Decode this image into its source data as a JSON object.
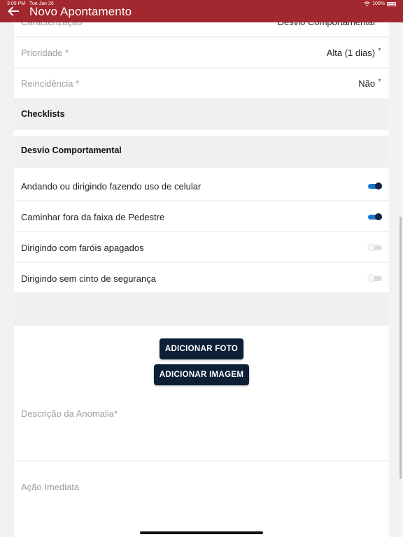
{
  "status_bar": {
    "time": "3:09 PM",
    "date": "Tue Jan 26",
    "battery": "100%"
  },
  "header": {
    "title": "Novo Apontamento"
  },
  "fields": [
    {
      "label": "Caracterização",
      "value": "Desvio Comportamental"
    },
    {
      "label": "Prioridade *",
      "value": "Alta (1 dias)"
    },
    {
      "label": "Reincidência *",
      "value": "Não"
    }
  ],
  "sections": {
    "checklists": "Checklists",
    "desvio": "Desvio Comportamental"
  },
  "checklist_items": [
    {
      "label": "Andando ou dirigindo fazendo uso de celular",
      "checked": true
    },
    {
      "label": "Caminhar fora da faixa de Pedestre",
      "checked": true
    },
    {
      "label": "Dirigindo com faróis apagados",
      "checked": false
    },
    {
      "label": "Dirigindo sem cinto de segurança",
      "checked": false
    }
  ],
  "buttons": {
    "add_photo": "ADICIONAR FOTO",
    "add_image": "ADICIONAR IMAGEM"
  },
  "text_fields": {
    "descricao_placeholder": "Descrição da Anomalia*",
    "acao_placeholder": "Ação Imediata"
  },
  "colors": {
    "header": "#a3272e",
    "button": "#0d1f37",
    "toggle_on": "#1677c8"
  }
}
